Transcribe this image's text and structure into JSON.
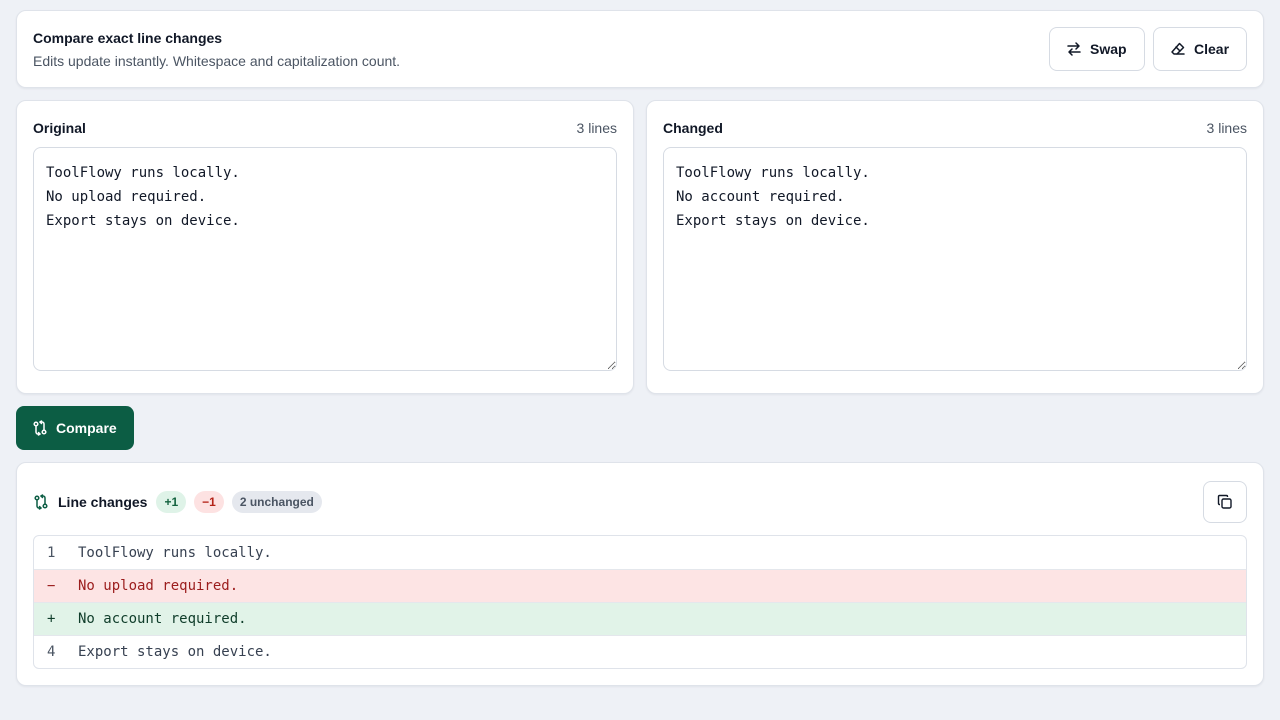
{
  "header": {
    "title": "Compare exact line changes",
    "subtitle": "Edits update instantly. Whitespace and capitalization count.",
    "swap_label": "Swap",
    "clear_label": "Clear"
  },
  "original": {
    "label": "Original",
    "count": "3 lines",
    "text": "ToolFlowy runs locally.\nNo upload required.\nExport stays on device."
  },
  "changed": {
    "label": "Changed",
    "count": "3 lines",
    "text": "ToolFlowy runs locally.\nNo account required.\nExport stays on device."
  },
  "compare_label": "Compare",
  "results": {
    "title": "Line changes",
    "added_badge": "+1",
    "removed_badge": "−1",
    "unchanged_badge": "2 unchanged",
    "rows": [
      {
        "kind": "same",
        "gutter": "1",
        "text": "ToolFlowy runs locally."
      },
      {
        "kind": "removed",
        "gutter": "−",
        "text": "No upload required."
      },
      {
        "kind": "added",
        "gutter": "+",
        "text": "No account required."
      },
      {
        "kind": "same",
        "gutter": "4",
        "text": "Export stays on device."
      }
    ]
  },
  "colors": {
    "accent": "#0c5d44",
    "added_bg": "#e1f3e8",
    "removed_bg": "#fde4e4",
    "page_bg": "#eef1f6"
  },
  "icons": {
    "swap": "swap-arrows-icon",
    "clear": "eraser-icon",
    "compare": "git-compare-icon",
    "copy": "copy-icon"
  }
}
